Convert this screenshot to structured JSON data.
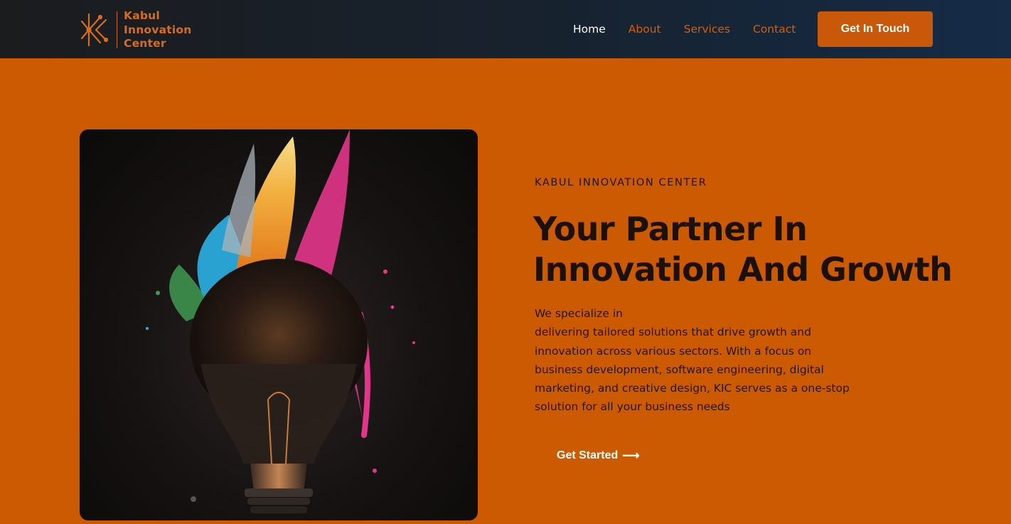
{
  "brand": {
    "line1": "Kabul",
    "line2": "Innovation",
    "line3": "Center",
    "color": "#d96d1c"
  },
  "nav": {
    "items": [
      {
        "label": "Home",
        "active": true
      },
      {
        "label": "About",
        "active": false
      },
      {
        "label": "Services",
        "active": false
      },
      {
        "label": "Contact",
        "active": false
      }
    ],
    "cta_label": "Get In Touch"
  },
  "hero": {
    "image_icon": "lightbulb-paint-splash-icon",
    "eyebrow": "KABUL INNOVATION CENTER",
    "headline_line1": "Your Partner In",
    "headline_line2": "Innovation And Growth",
    "description_lines": [
      "We specialize in",
      "delivering tailored solutions that drive growth and",
      "innovation across various sectors. With a focus on",
      "business development, software engineering, digital",
      "marketing, and creative design, KIC serves as a one-stop",
      "solution for all your business needs"
    ],
    "cta_label": "Get Started",
    "cta_icon": "arrow-right-icon"
  },
  "colors": {
    "accent": "#cb5a02",
    "nav_bg": "#17222f",
    "text_dark": "#1c1008",
    "white": "#ffffff"
  }
}
